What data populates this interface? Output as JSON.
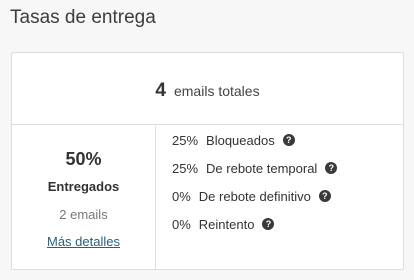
{
  "page": {
    "title": "Tasas de entrega"
  },
  "summary": {
    "total_count": "4",
    "total_label": "emails totales"
  },
  "delivered": {
    "percent": "50%",
    "label": "Entregados",
    "count": "2 emails",
    "link": "Más detalles"
  },
  "stats": [
    {
      "percent": "25%",
      "label": "Bloqueados",
      "icon": "help-icon"
    },
    {
      "percent": "25%",
      "label": "De rebote temporal",
      "icon": "help-icon"
    },
    {
      "percent": "0%",
      "label": "De rebote definitivo",
      "icon": "help-icon"
    },
    {
      "percent": "0%",
      "label": "Reintento",
      "icon": "help-icon"
    }
  ],
  "colors": {
    "link": "#2a5f7a",
    "icon_bg": "#3a3a3a",
    "border": "#dddddd"
  }
}
